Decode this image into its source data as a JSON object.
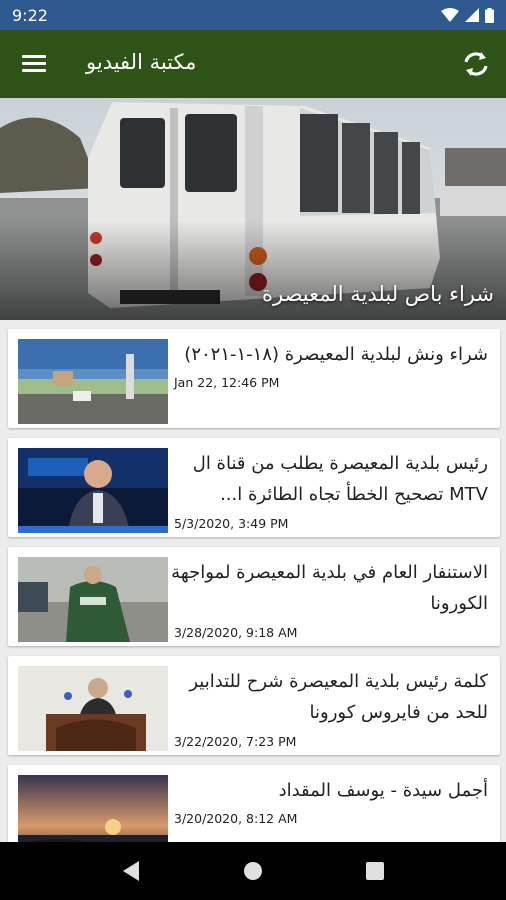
{
  "status_bar": {
    "time": "9:22"
  },
  "app_bar": {
    "title": "مكتبة الفيديو"
  },
  "hero": {
    "caption": "شراء باص لبلدية المعيصرة"
  },
  "videos": [
    {
      "title": "شراء ونش لبلدية المعيصرة (١٨-١-٢٠٢١)",
      "date": "Jan 22, 12:46 PM"
    },
    {
      "title": "رئيس بلدية المعيصرة يطلب من قناة ال MTV تصحيح الخطأ تجاه الطائرة ا...",
      "date": "5/3/2020, 3:49 PM"
    },
    {
      "title": "الاستنفار العام في بلدية المعيصرة لمواجهة الكورونا",
      "date": "3/28/2020, 9:18 AM"
    },
    {
      "title": "كلمة رئيس بلدية المعيصرة شرح للتدابير للحد من فايروس كورونا",
      "date": "3/22/2020, 7:23 PM"
    },
    {
      "title": "أجمل سيدة - يوسف المقداد",
      "date": "3/20/2020, 8:12 AM"
    }
  ],
  "colors": {
    "status_bar": "#2f5a8f",
    "app_bar": "#2d5316",
    "nav_bar": "#000000",
    "background": "#ececec"
  }
}
